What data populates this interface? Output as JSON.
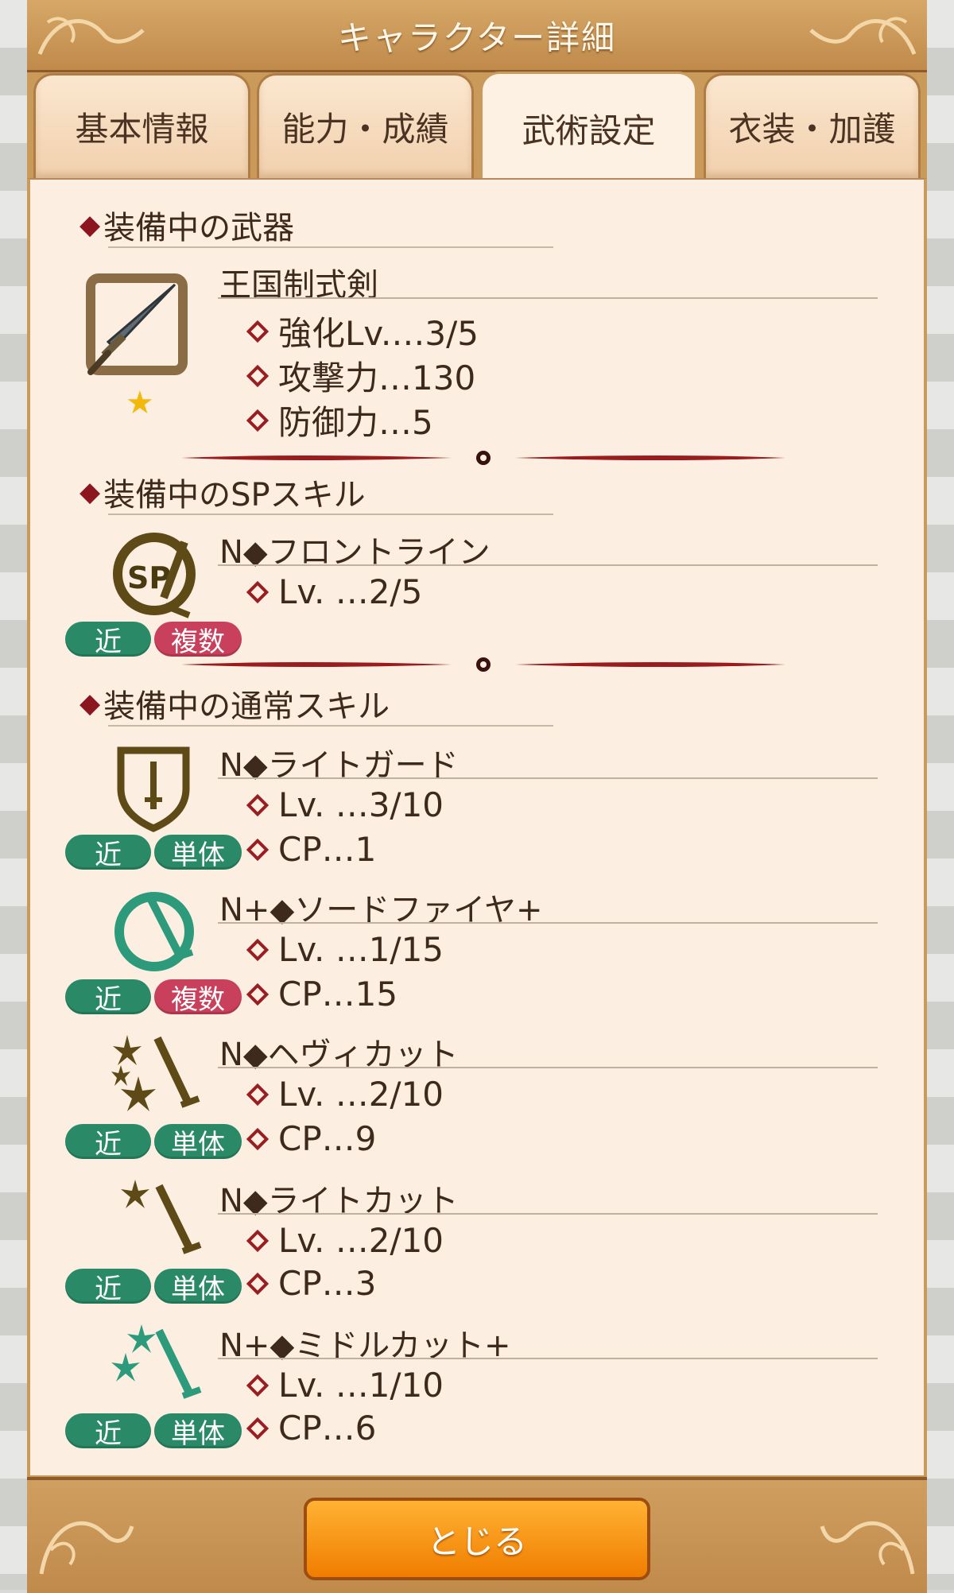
{
  "header": {
    "title": "キャラクター詳細"
  },
  "tabs": [
    {
      "label": "基本情報"
    },
    {
      "label": "能力・成績"
    },
    {
      "label": "武術設定",
      "active": true
    },
    {
      "label": "衣装・加護"
    }
  ],
  "weapon_section": {
    "title": "装備中の武器",
    "weapon": {
      "name": "王国制式剣",
      "rarity_stars": 1,
      "icon": "sword-icon",
      "stats": [
        {
          "label": "強化Lv.…3/5"
        },
        {
          "label": "攻撃力…130"
        },
        {
          "label": "防御力…5"
        }
      ]
    }
  },
  "sp_section": {
    "title": "装備中のSPスキル",
    "skill": {
      "name": "N◆フロントライン",
      "icon": "sp-skill-icon",
      "level": "Lv. …2/5",
      "range": "近",
      "target": "複数"
    }
  },
  "normal_section": {
    "title": "装備中の通常スキル",
    "skills": [
      {
        "name": "N◆ライトガード",
        "icon": "shield-sword-icon",
        "level": "Lv. …3/10",
        "cp": "CP…1",
        "range": "近",
        "target": "単体"
      },
      {
        "name": "N+◆ソードファイヤ+",
        "icon": "sword-ring-icon",
        "level": "Lv. …1/15",
        "cp": "CP…15",
        "range": "近",
        "target": "複数"
      },
      {
        "name": "N◆ヘヴィカット",
        "icon": "sword-burst-icon",
        "level": "Lv. …2/10",
        "cp": "CP…9",
        "range": "近",
        "target": "単体"
      },
      {
        "name": "N◆ライトカット",
        "icon": "sword-spark-icon",
        "level": "Lv. …2/10",
        "cp": "CP…3",
        "range": "近",
        "target": "単体"
      },
      {
        "name": "N+◆ミドルカット+",
        "icon": "sword-twin-spark-icon",
        "level": "Lv. …1/10",
        "cp": "CP…6",
        "range": "近",
        "target": "単体"
      }
    ]
  },
  "footer": {
    "close_label": "とじる"
  },
  "colors": {
    "badge_green": "#2a8a67",
    "badge_red": "#c9405c",
    "accent_diamond": "#8b1620",
    "close_button": "#f07d00"
  }
}
